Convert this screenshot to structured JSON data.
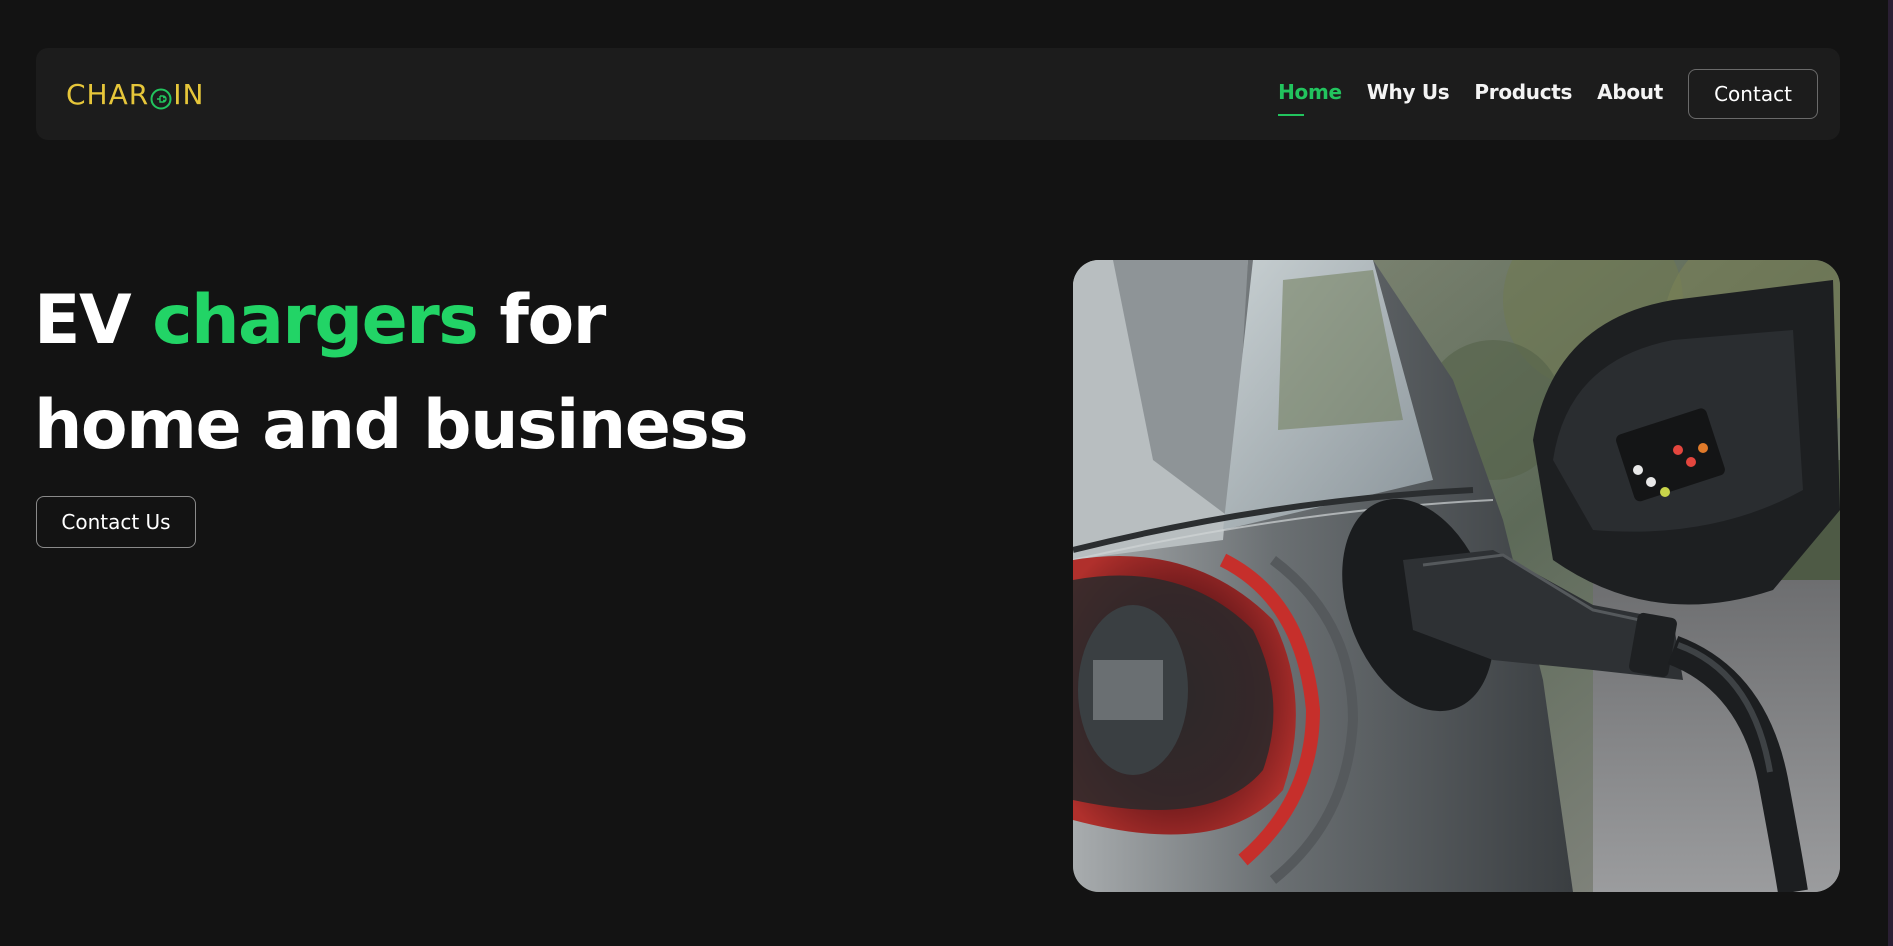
{
  "brand": {
    "logo_prefix": "CHAR",
    "logo_suffix": "IN",
    "logo_icon": "plug-icon",
    "color": "#e6c63a"
  },
  "nav": {
    "items": [
      {
        "label": "Home",
        "active": true
      },
      {
        "label": "Why Us",
        "active": false
      },
      {
        "label": "Products",
        "active": false
      },
      {
        "label": "About",
        "active": false
      }
    ],
    "contact_label": "Contact"
  },
  "hero": {
    "title_part1": "EV ",
    "title_highlight": "chargers",
    "title_part2": " for",
    "title_line2": "home and business",
    "cta_label": "Contact Us",
    "image": "ev-charging-car-photo"
  },
  "colors": {
    "background": "#131313",
    "navbar": "#1c1c1c",
    "accent_green": "#22d466",
    "logo_yellow": "#e6c63a"
  }
}
